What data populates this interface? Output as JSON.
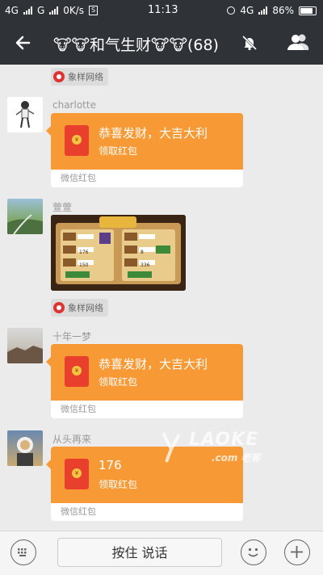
{
  "status_bar": {
    "network_1": "4G",
    "network_2": "G",
    "speed": "0K/s",
    "time": "11:13",
    "network_right": "4G",
    "battery": "86%"
  },
  "nav": {
    "title": "🐮🐮和气生财🐮🐮(68)"
  },
  "messages": {
    "sys1": "象样网络",
    "sys2": "象样网络",
    "m1": {
      "name": "charlotte",
      "wish": "恭喜发财，大吉大利",
      "action": "领取红包",
      "footer": "微信红包"
    },
    "m2": {
      "name": "萱萱"
    },
    "m3": {
      "name": "十年一梦",
      "wish": "恭喜发财，大吉大利",
      "action": "领取红包",
      "footer": "微信红包"
    },
    "m4": {
      "name": "从头再来",
      "wish": "176",
      "action": "领取红包",
      "footer": "微信红包"
    }
  },
  "game": {
    "values": [
      "176",
      "8",
      "150",
      "336"
    ]
  },
  "watermark": {
    "brand": "LAOKE",
    "sub": ".com 老客"
  },
  "input": {
    "voice_label": "按住 说话"
  },
  "colors": {
    "bar": "#2f3236",
    "red_packet": "#f79a35",
    "chat_bg": "#ebebeb"
  }
}
